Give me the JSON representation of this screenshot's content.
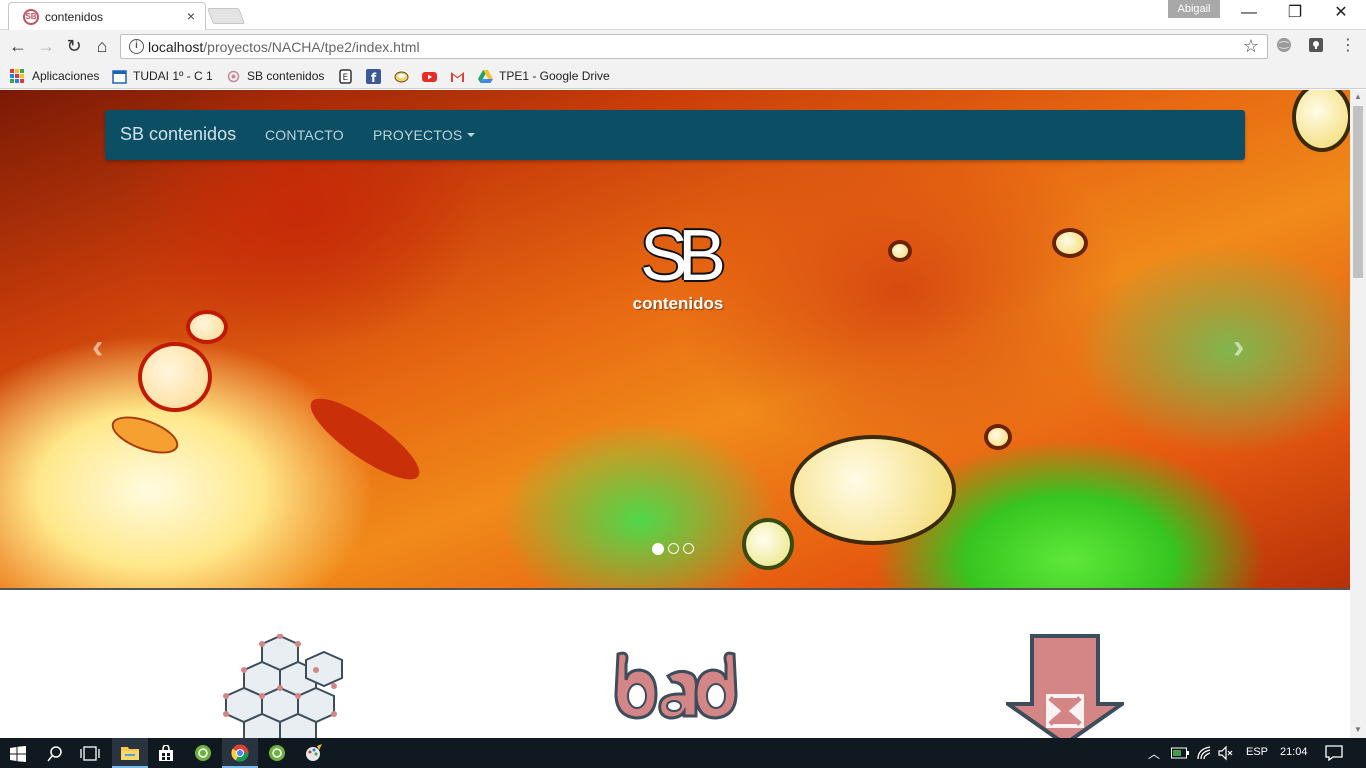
{
  "browser": {
    "tab_title": "contenidos",
    "tab_close": "×",
    "profile_name": "Abigail",
    "window_controls": {
      "minimize": "—",
      "maximize": "❐",
      "close": "✕"
    },
    "nav": {
      "back": "←",
      "forward": "→",
      "reload": "↻",
      "home": "⌂"
    },
    "url_host": "localhost",
    "url_path": "/proyectos/NACHA/tpe2/index.html",
    "star": "☆",
    "menu": "⋮"
  },
  "bookmarks": [
    {
      "label": "Aplicaciones",
      "icon": "apps-grid-icon"
    },
    {
      "label": "TUDAI 1º - C 1",
      "icon": "calendar-icon"
    },
    {
      "label": "SB contenidos",
      "icon": "sb-icon"
    },
    {
      "label": "",
      "icon": "e-icon"
    },
    {
      "label": "",
      "icon": "facebook-icon"
    },
    {
      "label": "",
      "icon": "bowl-icon"
    },
    {
      "label": "",
      "icon": "youtube-icon"
    },
    {
      "label": "",
      "icon": "gmail-icon"
    },
    {
      "label": "TPE1 - Google Drive",
      "icon": "google-drive-icon"
    }
  ],
  "site": {
    "brand": "SB contenidos",
    "nav_links": [
      "CONTACTO",
      "PROYECTOS"
    ],
    "logo_text": "SB",
    "logo_sub": "contenidos",
    "carousel": {
      "prev": "‹",
      "next": "›",
      "slides": 3,
      "active": 0
    }
  },
  "features": [
    "hexagon-network-icon",
    "bad-logo-icon",
    "download-arrow-icon"
  ],
  "feature_labels": {
    "bad": "bad"
  },
  "colors": {
    "navbar": "#0c4f65",
    "feature_fill": "#d48585",
    "feature_stroke": "#3d4d5c"
  },
  "taskbar": {
    "language": "ESP",
    "time": "21:04"
  }
}
